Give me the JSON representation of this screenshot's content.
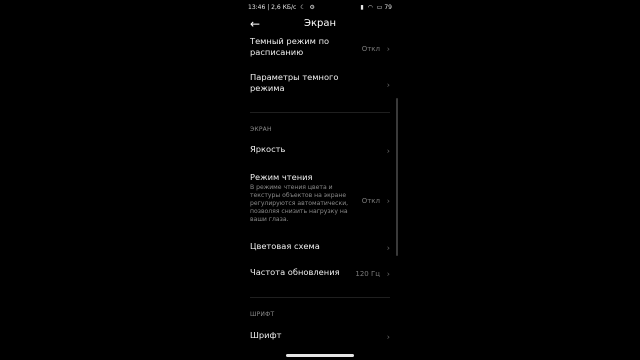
{
  "status_bar": {
    "time": "13:46",
    "net": "| 2,6 КБ/с",
    "left_icons": [
      "moon-icon",
      "gear-icon"
    ],
    "right_icons": [
      "signal-icon",
      "wifi-icon",
      "battery-icon"
    ],
    "battery": "79"
  },
  "header": {
    "back_glyph": "←",
    "title": "Экран"
  },
  "rows": {
    "dark_schedule": {
      "label": "Темный режим по расписанию",
      "value": "Откл"
    },
    "dark_params": {
      "label": "Параметры темного режима"
    },
    "brightness": {
      "label": "Яркость"
    },
    "reading_mode": {
      "label": "Режим чтения",
      "desc": "В режиме чтения цвета и текстуры объектов на экране регулируются автоматически, позволяя снизить нагрузку на ваши глаза.",
      "value": "Откл"
    },
    "color_scheme": {
      "label": "Цветовая схема"
    },
    "refresh_rate": {
      "label": "Частота обновления",
      "value": "120 Гц"
    },
    "font": {
      "label": "Шрифт"
    }
  },
  "sections": {
    "screen": "ЭКРАН",
    "font": "ШРИФТ"
  },
  "chevron": "›"
}
